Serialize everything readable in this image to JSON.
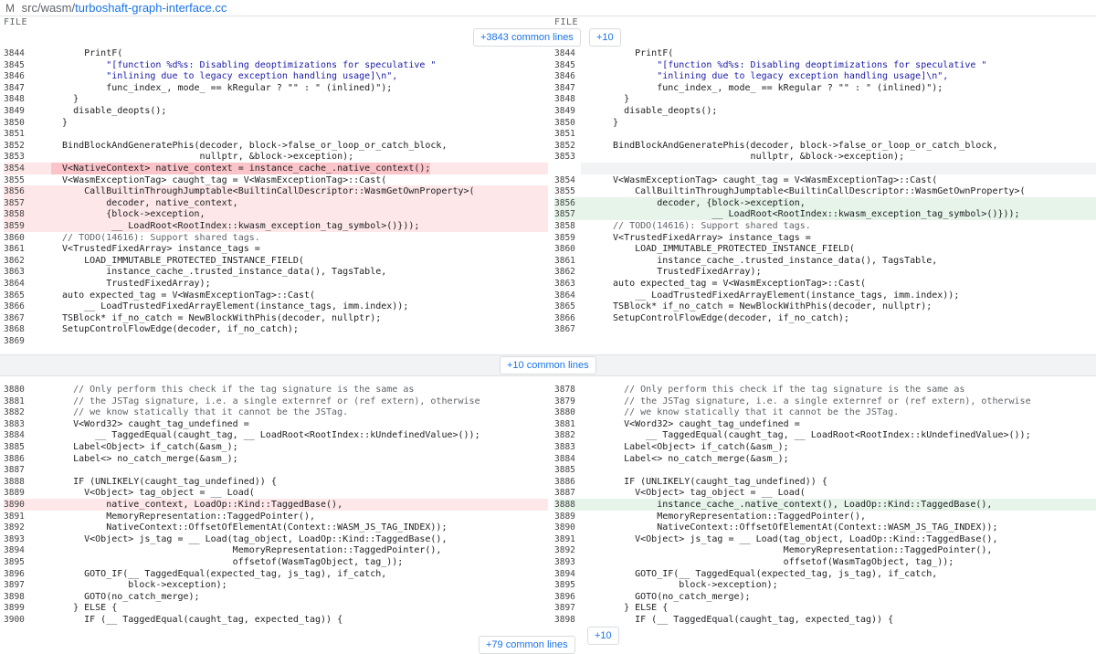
{
  "topbar": {
    "badge": "M",
    "path": "src/wasm/",
    "filename": "turboshaft-graph-interface.cc"
  },
  "headers": {
    "left": "FILE",
    "right": "FILE"
  },
  "buttons": {
    "top_common": "+3843 common lines",
    "top_plus": "+10",
    "mid_common": "+10 common lines",
    "bottom_plus": "+10",
    "bottom_common": "+79 common lines"
  },
  "left_top": [
    {
      "ln": "3844",
      "t": "      PrintF("
    },
    {
      "ln": "3845",
      "t": "          \"[function %d%s: Disabling deoptimizations for speculative \"",
      "cls": "s"
    },
    {
      "ln": "3846",
      "t": "          \"inlining due to legacy exception handling usage]\\n\",",
      "cls": "s"
    },
    {
      "ln": "3847",
      "t": "          func_index_, mode_ == kRegular ? \"\" : \" (inlined)\");"
    },
    {
      "ln": "3848",
      "t": "    }"
    },
    {
      "ln": "3849",
      "t": "    disable_deopts();"
    },
    {
      "ln": "3850",
      "t": "  }"
    },
    {
      "ln": "3851",
      "t": ""
    },
    {
      "ln": "3852",
      "t": "  BindBlockAndGeneratePhis(decoder, block->false_or_loop_or_catch_block,"
    },
    {
      "ln": "3853",
      "t": "                           nullptr, &block->exception);"
    },
    {
      "ln": "3854",
      "t": "  V<NativeContext> native_context = instance_cache_.native_context();",
      "type": "del",
      "hl": true
    },
    {
      "ln": "3855",
      "t": "  V<WasmExceptionTag> caught_tag = V<WasmExceptionTag>::Cast("
    },
    {
      "ln": "3856",
      "t": "      CallBuiltinThroughJumptable<BuiltinCallDescriptor::WasmGetOwnProperty>(",
      "type": "del"
    },
    {
      "ln": "3857",
      "t": "          decoder, native_context,",
      "type": "del"
    },
    {
      "ln": "3858",
      "t": "          {block->exception,",
      "type": "del"
    },
    {
      "ln": "3859",
      "t": "           __ LoadRoot<RootIndex::kwasm_exception_tag_symbol>()}));",
      "type": "del"
    },
    {
      "ln": "3860",
      "t": "  // TODO(14616): Support shared tags.",
      "cls": "c"
    },
    {
      "ln": "3861",
      "t": "  V<TrustedFixedArray> instance_tags ="
    },
    {
      "ln": "3862",
      "t": "      LOAD_IMMUTABLE_PROTECTED_INSTANCE_FIELD("
    },
    {
      "ln": "3863",
      "t": "          instance_cache_.trusted_instance_data(), TagsTable,"
    },
    {
      "ln": "3864",
      "t": "          TrustedFixedArray);"
    },
    {
      "ln": "3865",
      "t": "  auto expected_tag = V<WasmExceptionTag>::Cast("
    },
    {
      "ln": "3866",
      "t": "      __ LoadTrustedFixedArrayElement(instance_tags, imm.index));"
    },
    {
      "ln": "3867",
      "t": "  TSBlock* if_no_catch = NewBlockWithPhis(decoder, nullptr);"
    },
    {
      "ln": "3868",
      "t": "  SetupControlFlowEdge(decoder, if_no_catch);"
    },
    {
      "ln": "3869",
      "t": ""
    }
  ],
  "right_top": [
    {
      "ln": "3844",
      "t": "      PrintF("
    },
    {
      "ln": "3845",
      "t": "          \"[function %d%s: Disabling deoptimizations for speculative \"",
      "cls": "s"
    },
    {
      "ln": "3846",
      "t": "          \"inlining due to legacy exception handling usage]\\n\",",
      "cls": "s"
    },
    {
      "ln": "3847",
      "t": "          func_index_, mode_ == kRegular ? \"\" : \" (inlined)\");"
    },
    {
      "ln": "3848",
      "t": "    }"
    },
    {
      "ln": "3849",
      "t": "    disable_deopts();"
    },
    {
      "ln": "3850",
      "t": "  }"
    },
    {
      "ln": "3851",
      "t": ""
    },
    {
      "ln": "3852",
      "t": "  BindBlockAndGeneratePhis(decoder, block->false_or_loop_or_catch_block,"
    },
    {
      "ln": "3853",
      "t": "                           nullptr, &block->exception);"
    },
    {
      "ln": "",
      "t": "",
      "type": "blank"
    },
    {
      "ln": "3854",
      "t": "  V<WasmExceptionTag> caught_tag = V<WasmExceptionTag>::Cast("
    },
    {
      "ln": "3855",
      "t": "      CallBuiltinThroughJumptable<BuiltinCallDescriptor::WasmGetOwnProperty>("
    },
    {
      "ln": "3856",
      "t": "          decoder, {block->exception,",
      "type": "add"
    },
    {
      "ln": "3857",
      "t": "                    __ LoadRoot<RootIndex::kwasm_exception_tag_symbol>()}));",
      "type": "add"
    },
    {
      "ln": "3858",
      "t": "  // TODO(14616): Support shared tags.",
      "cls": "c"
    },
    {
      "ln": "3859",
      "t": "  V<TrustedFixedArray> instance_tags ="
    },
    {
      "ln": "3860",
      "t": "      LOAD_IMMUTABLE_PROTECTED_INSTANCE_FIELD("
    },
    {
      "ln": "3861",
      "t": "          instance_cache_.trusted_instance_data(), TagsTable,"
    },
    {
      "ln": "3862",
      "t": "          TrustedFixedArray);"
    },
    {
      "ln": "3863",
      "t": "  auto expected_tag = V<WasmExceptionTag>::Cast("
    },
    {
      "ln": "3864",
      "t": "      __ LoadTrustedFixedArrayElement(instance_tags, imm.index));"
    },
    {
      "ln": "3865",
      "t": "  TSBlock* if_no_catch = NewBlockWithPhis(decoder, nullptr);"
    },
    {
      "ln": "3866",
      "t": "  SetupControlFlowEdge(decoder, if_no_catch);"
    },
    {
      "ln": "3867",
      "t": ""
    }
  ],
  "left_bottom": [
    {
      "ln": "3880",
      "t": "    // Only perform this check if the tag signature is the same as",
      "cls": "c"
    },
    {
      "ln": "3881",
      "t": "    // the JSTag signature, i.e. a single externref or (ref extern), otherwise",
      "cls": "c"
    },
    {
      "ln": "3882",
      "t": "    // we know statically that it cannot be the JSTag.",
      "cls": "c"
    },
    {
      "ln": "3883",
      "t": "    V<Word32> caught_tag_undefined ="
    },
    {
      "ln": "3884",
      "t": "        __ TaggedEqual(caught_tag, __ LoadRoot<RootIndex::kUndefinedValue>());"
    },
    {
      "ln": "3885",
      "t": "    Label<Object> if_catch(&asm_);"
    },
    {
      "ln": "3886",
      "t": "    Label<> no_catch_merge(&asm_);"
    },
    {
      "ln": "3887",
      "t": ""
    },
    {
      "ln": "3888",
      "t": "    IF (UNLIKELY(caught_tag_undefined)) {"
    },
    {
      "ln": "3889",
      "t": "      V<Object> tag_object = __ Load("
    },
    {
      "ln": "3890",
      "t": "          native_context, LoadOp::Kind::TaggedBase(),",
      "type": "del"
    },
    {
      "ln": "3891",
      "t": "          MemoryRepresentation::TaggedPointer(),"
    },
    {
      "ln": "3892",
      "t": "          NativeContext::OffsetOfElementAt(Context::WASM_JS_TAG_INDEX));"
    },
    {
      "ln": "3893",
      "t": "      V<Object> js_tag = __ Load(tag_object, LoadOp::Kind::TaggedBase(),"
    },
    {
      "ln": "3894",
      "t": "                                 MemoryRepresentation::TaggedPointer(),"
    },
    {
      "ln": "3895",
      "t": "                                 offsetof(WasmTagObject, tag_));"
    },
    {
      "ln": "3896",
      "t": "      GOTO_IF(__ TaggedEqual(expected_tag, js_tag), if_catch,"
    },
    {
      "ln": "3897",
      "t": "              block->exception);"
    },
    {
      "ln": "3898",
      "t": "      GOTO(no_catch_merge);"
    },
    {
      "ln": "3899",
      "t": "    } ELSE {"
    },
    {
      "ln": "3900",
      "t": "      IF (__ TaggedEqual(caught_tag, expected_tag)) {"
    }
  ],
  "right_bottom": [
    {
      "ln": "3878",
      "t": "    // Only perform this check if the tag signature is the same as",
      "cls": "c"
    },
    {
      "ln": "3879",
      "t": "    // the JSTag signature, i.e. a single externref or (ref extern), otherwise",
      "cls": "c"
    },
    {
      "ln": "3880",
      "t": "    // we know statically that it cannot be the JSTag.",
      "cls": "c"
    },
    {
      "ln": "3881",
      "t": "    V<Word32> caught_tag_undefined ="
    },
    {
      "ln": "3882",
      "t": "        __ TaggedEqual(caught_tag, __ LoadRoot<RootIndex::kUndefinedValue>());"
    },
    {
      "ln": "3883",
      "t": "    Label<Object> if_catch(&asm_);"
    },
    {
      "ln": "3884",
      "t": "    Label<> no_catch_merge(&asm_);"
    },
    {
      "ln": "3885",
      "t": ""
    },
    {
      "ln": "3886",
      "t": "    IF (UNLIKELY(caught_tag_undefined)) {"
    },
    {
      "ln": "3887",
      "t": "      V<Object> tag_object = __ Load("
    },
    {
      "ln": "3888",
      "t": "          instance_cache_.native_context(), LoadOp::Kind::TaggedBase(),",
      "type": "add"
    },
    {
      "ln": "3889",
      "t": "          MemoryRepresentation::TaggedPointer(),"
    },
    {
      "ln": "3890",
      "t": "          NativeContext::OffsetOfElementAt(Context::WASM_JS_TAG_INDEX));"
    },
    {
      "ln": "3891",
      "t": "      V<Object> js_tag = __ Load(tag_object, LoadOp::Kind::TaggedBase(),"
    },
    {
      "ln": "3892",
      "t": "                                 MemoryRepresentation::TaggedPointer(),"
    },
    {
      "ln": "3893",
      "t": "                                 offsetof(WasmTagObject, tag_));"
    },
    {
      "ln": "3894",
      "t": "      GOTO_IF(__ TaggedEqual(expected_tag, js_tag), if_catch,"
    },
    {
      "ln": "3895",
      "t": "              block->exception);"
    },
    {
      "ln": "3896",
      "t": "      GOTO(no_catch_merge);"
    },
    {
      "ln": "3897",
      "t": "    } ELSE {"
    },
    {
      "ln": "3898",
      "t": "      IF (__ TaggedEqual(caught_tag, expected_tag)) {"
    }
  ]
}
